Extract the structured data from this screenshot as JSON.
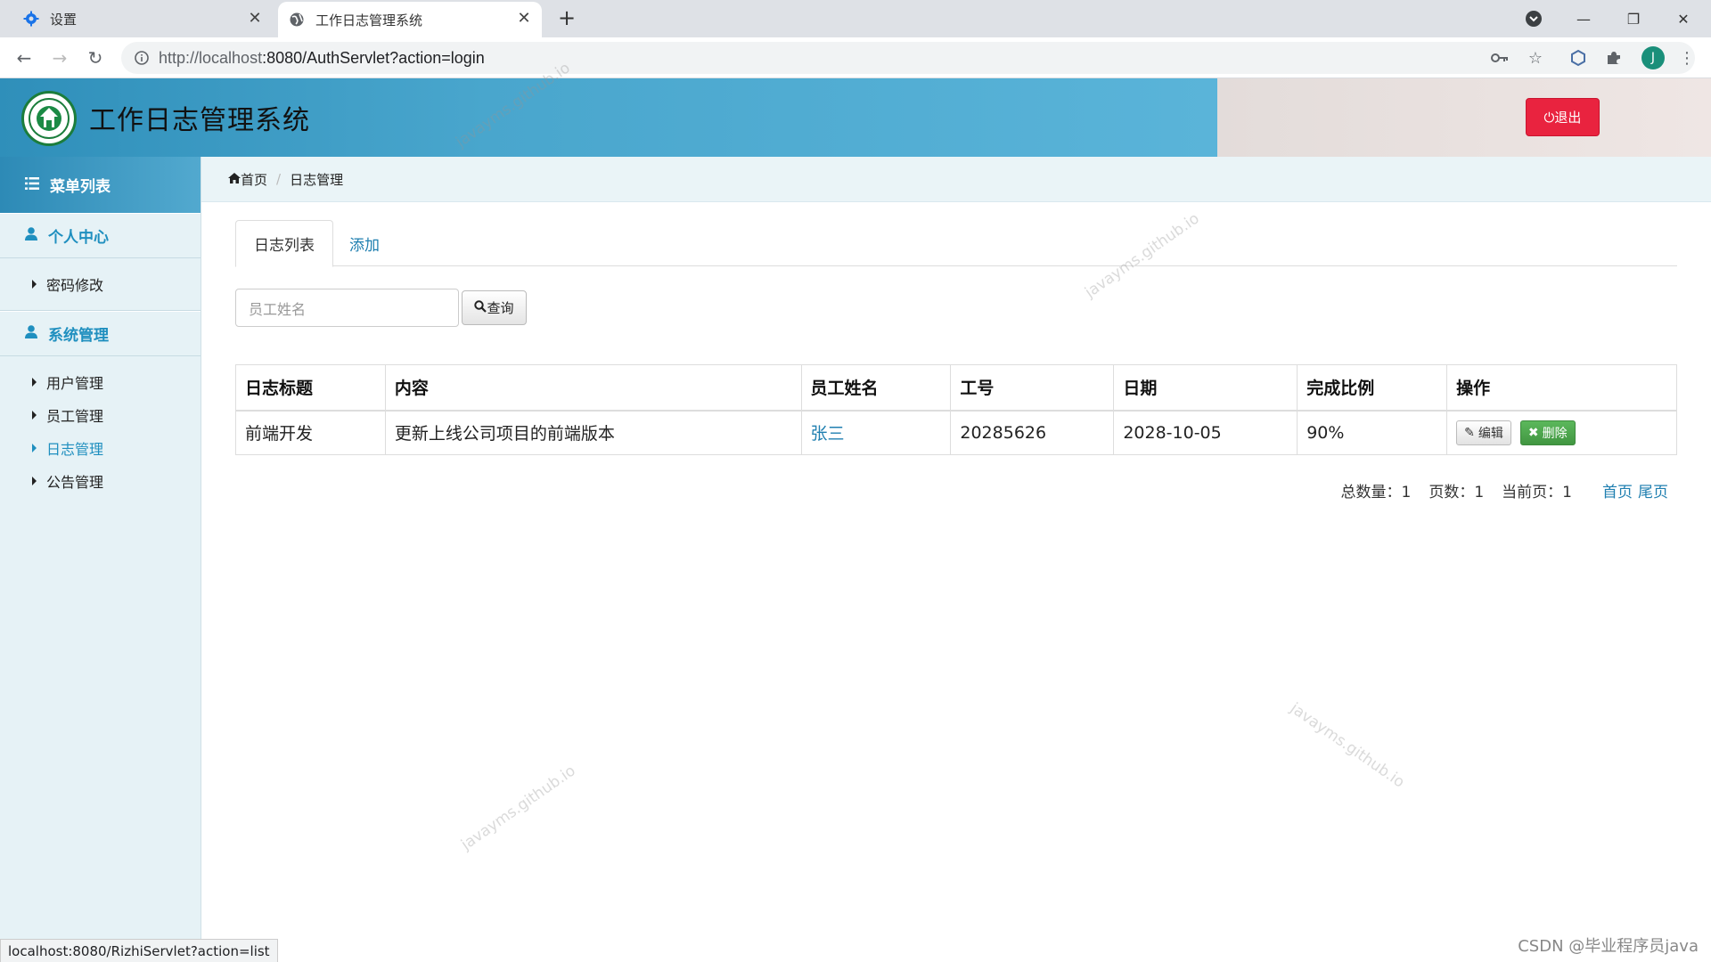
{
  "browser": {
    "tabs": [
      {
        "title": "设置",
        "icon": "gear-icon"
      },
      {
        "title": "工作日志管理系统",
        "icon": "globe-icon"
      }
    ],
    "url_host": "http://localhost",
    "url_rest": ":8080/AuthServlet?action=login",
    "avatar_letter": "J",
    "status_url": "localhost:8080/RizhiServlet?action=list"
  },
  "header": {
    "title": "工作日志管理系统",
    "logout_label": "退出"
  },
  "sidebar": {
    "menu_title": "菜单列表",
    "groups": [
      {
        "label": "个人中心",
        "items": [
          {
            "label": "密码修改"
          }
        ]
      },
      {
        "label": "系统管理",
        "items": [
          {
            "label": "用户管理"
          },
          {
            "label": "员工管理"
          },
          {
            "label": "日志管理",
            "active": true
          },
          {
            "label": "公告管理"
          }
        ]
      }
    ]
  },
  "breadcrumb": {
    "home": "首页",
    "current": "日志管理"
  },
  "main": {
    "tabs": [
      {
        "label": "日志列表"
      },
      {
        "label": "添加"
      }
    ],
    "search": {
      "placeholder": "员工姓名",
      "button_label": "查询"
    },
    "table": {
      "headers": [
        "日志标题",
        "内容",
        "员工姓名",
        "工号",
        "日期",
        "完成比例",
        "操作"
      ],
      "rows": [
        {
          "title": "前端开发",
          "content": "更新上线公司项目的前端版本",
          "employee": "张三",
          "emp_no": "20285626",
          "date": "2028-10-05",
          "ratio": "90%"
        }
      ],
      "edit_label": "编辑",
      "delete_label": "删除"
    },
    "pager": {
      "total_label": "总数量：1",
      "pages_label": "页数：1",
      "current_label": "当前页：1",
      "first_label": "首页",
      "last_label": "尾页"
    }
  },
  "watermark_text": "javayms.github.io",
  "footer_credit": "CSDN @毕业程序员java",
  "colors": {
    "accent": "#1f8fbf",
    "danger": "#e9233f",
    "success": "#5cb85c"
  }
}
